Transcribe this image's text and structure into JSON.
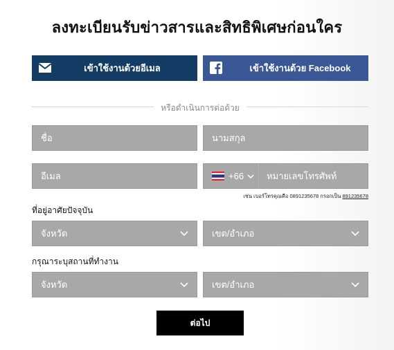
{
  "title": "ลงทะเบียนรับข่าวสารและสิทธิพิเศษก่อนใคร",
  "social": {
    "email_label": "เข้าใช้งานด้วยอีเมล",
    "facebook_label": "เข้าใช้งานด้วย Facebook",
    "email_icon": "envelope-icon",
    "facebook_icon": "facebook-icon",
    "email_color": "#143d66",
    "facebook_color": "#3a5796"
  },
  "divider_text": "หรือดำเนินการต่อด้วย",
  "form": {
    "first_name_placeholder": "ชื่อ",
    "last_name_placeholder": "นามสกุล",
    "email_placeholder": "อีเมล",
    "country_code": "+66",
    "phone_placeholder": "หมายเลขโทรศัพท์",
    "phone_hint_prefix": "เช่น เบอร์โทรคุณคือ 0891235678 กรอกเป็น",
    "phone_hint_example": "891235678",
    "residence_label": "ที่อยู่อาศัยปัจจุบัน",
    "residence_province": "จังหวัด",
    "residence_district": "เขต/อำเภอ",
    "work_label": "กรุณาระบุสถานที่ทำงาน",
    "work_province": "จังหวัด",
    "work_district": "เขต/อำเภอ"
  },
  "next_button": "ต่อไป",
  "field_color": "#a8a8a8"
}
